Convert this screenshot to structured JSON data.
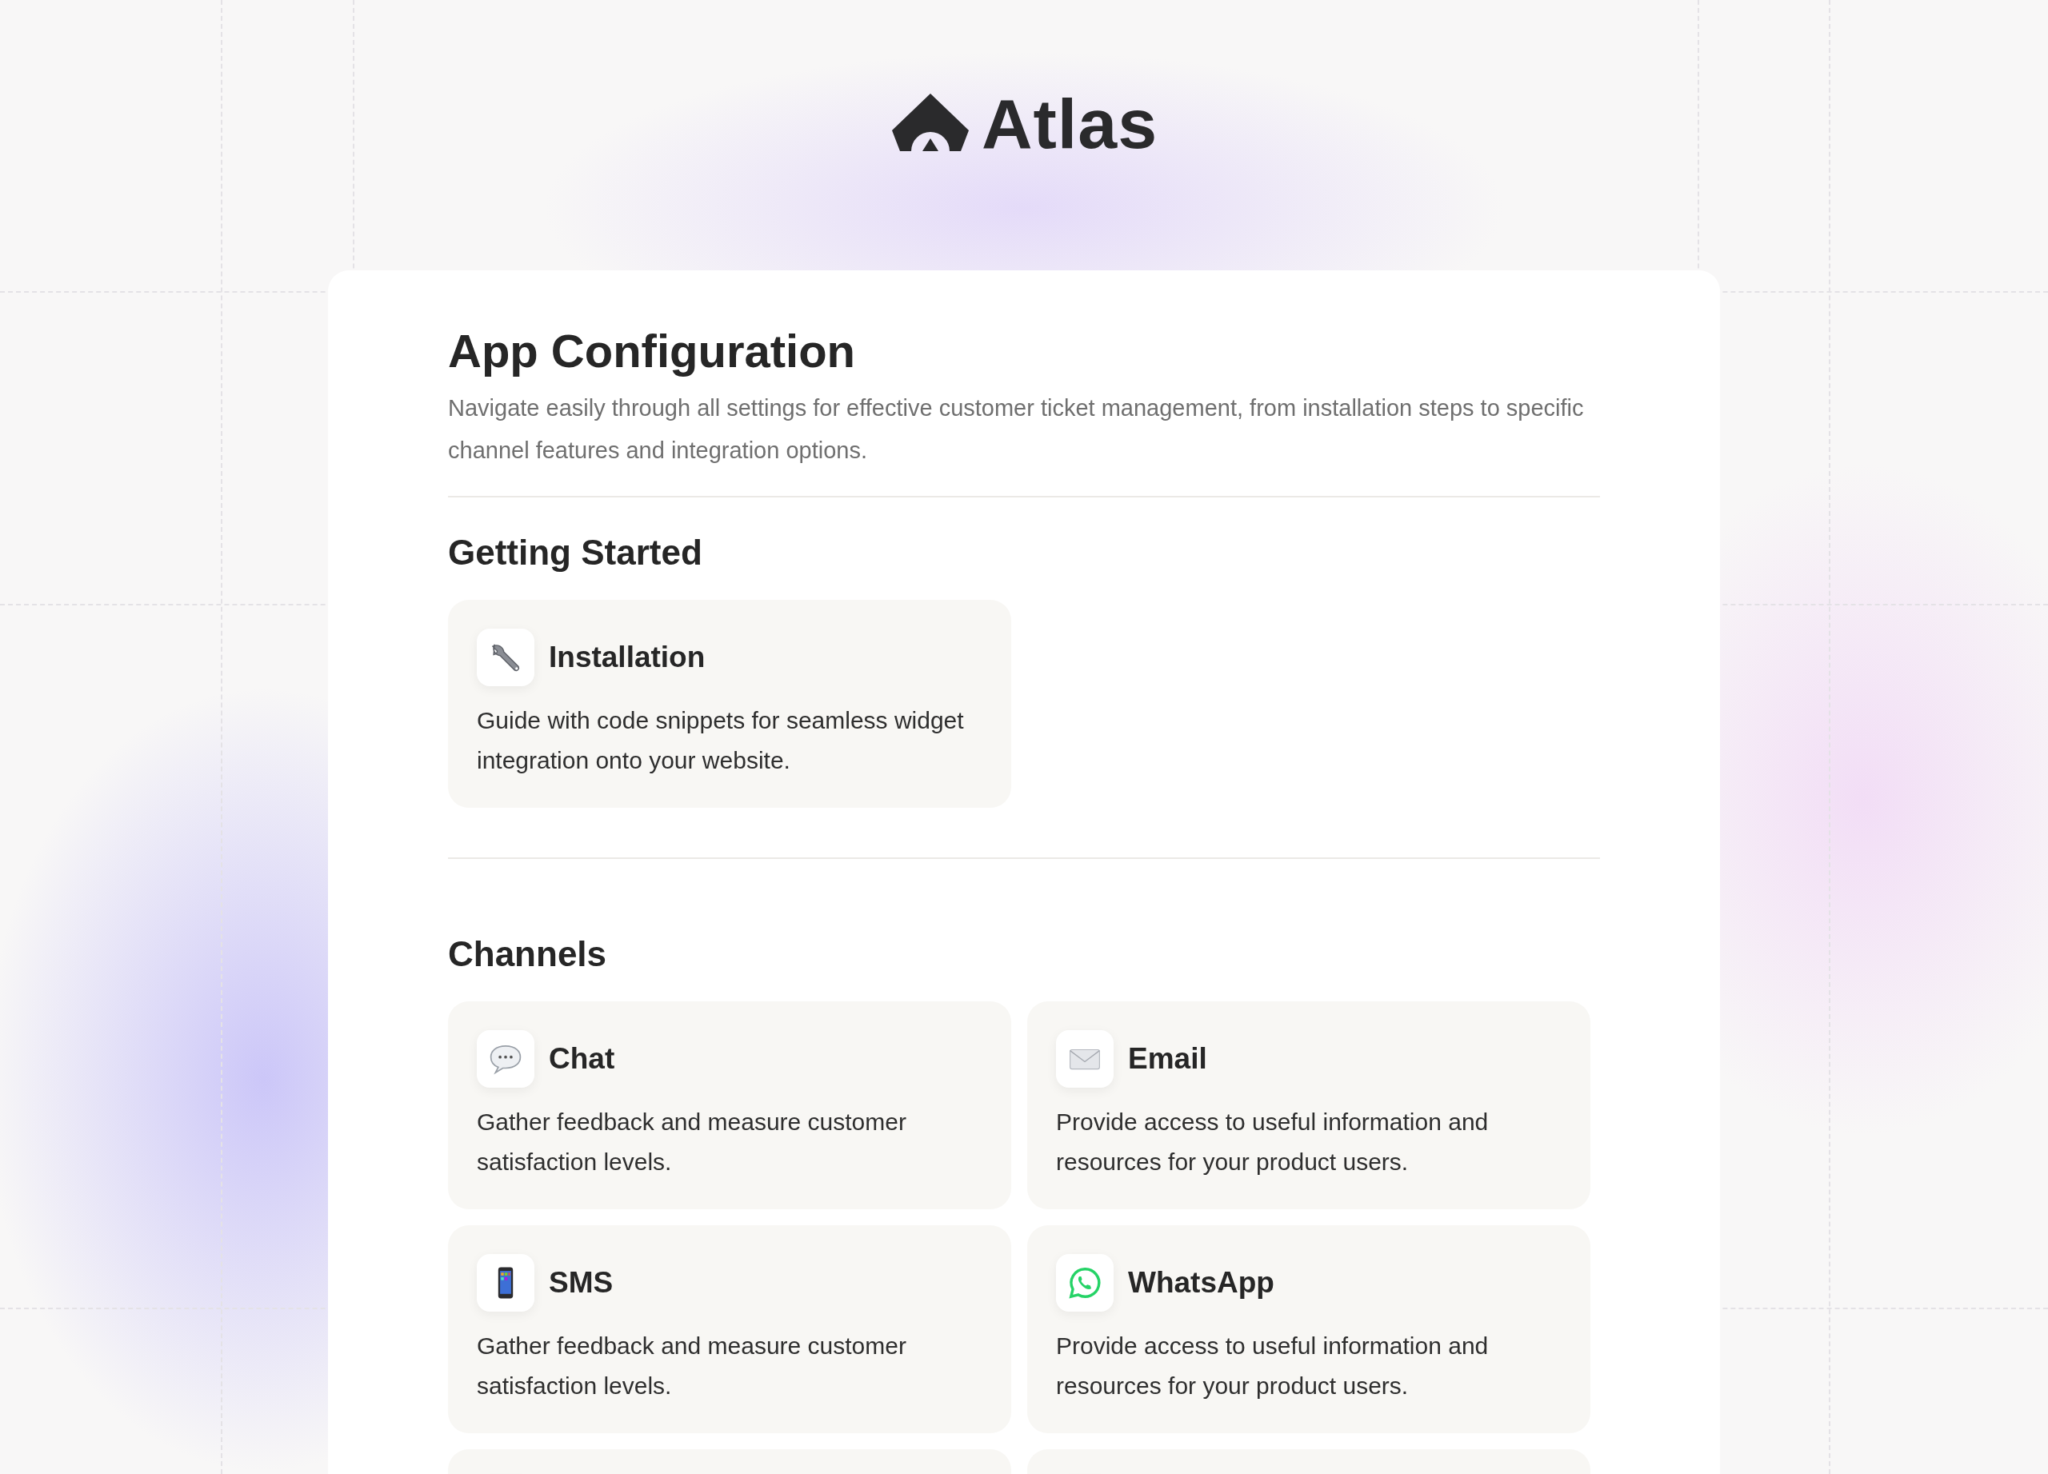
{
  "brand": {
    "name": "Atlas"
  },
  "header": {
    "title": "App Configuration",
    "description": "Navigate easily through all settings for effective customer ticket management, from installation steps to specific channel features and integration options."
  },
  "sections": [
    {
      "title": "Getting Started",
      "cards": [
        {
          "kind": "wrench",
          "title": "Installation",
          "description": "Guide with code snippets for seamless widget integration onto your website."
        }
      ]
    },
    {
      "title": "Channels",
      "cards": [
        {
          "kind": "chat",
          "title": "Chat",
          "description": "Gather feedback and measure customer satisfaction levels."
        },
        {
          "kind": "envelope",
          "title": "Email",
          "description": "Provide access to useful information and resources for your product users."
        },
        {
          "kind": "phone",
          "title": "SMS",
          "description": "Gather feedback and measure customer satisfaction levels."
        },
        {
          "kind": "whatsapp",
          "title": "WhatsApp",
          "description": "Provide access to useful information and resources for your product users."
        }
      ]
    }
  ]
}
